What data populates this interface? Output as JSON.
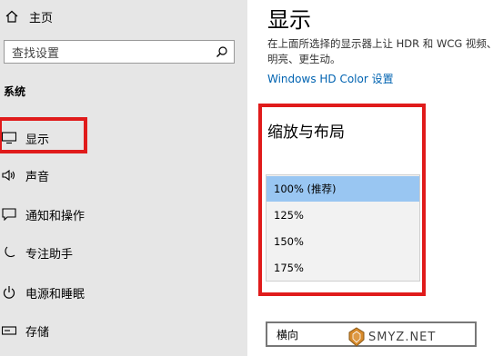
{
  "sidebar": {
    "home_label": "主页",
    "search_placeholder": "查找设置",
    "section_label": "系统",
    "items": [
      {
        "label": "显示",
        "icon": "monitor-icon"
      },
      {
        "label": "声音",
        "icon": "speaker-icon"
      },
      {
        "label": "通知和操作",
        "icon": "notification-icon"
      },
      {
        "label": "专注助手",
        "icon": "moon-icon"
      },
      {
        "label": "电源和睡眠",
        "icon": "power-icon"
      },
      {
        "label": "存储",
        "icon": "storage-icon"
      }
    ]
  },
  "main": {
    "title": "显示",
    "description": "在上面所选择的显示器上让 HDR 和 WCG 视频、明亮、更生动。",
    "hd_link": "Windows HD Color 设置",
    "section_title": "缩放与布局",
    "scale_options": [
      "100% (推荐)",
      "125%",
      "150%",
      "175%"
    ],
    "selected_scale": "100% (推荐)",
    "orientation_value": "横向"
  },
  "watermark": "SMYZ.NET",
  "colors": {
    "accent": "#0063b1",
    "highlight": "#e01b1b",
    "selection": "#99c6f2"
  }
}
